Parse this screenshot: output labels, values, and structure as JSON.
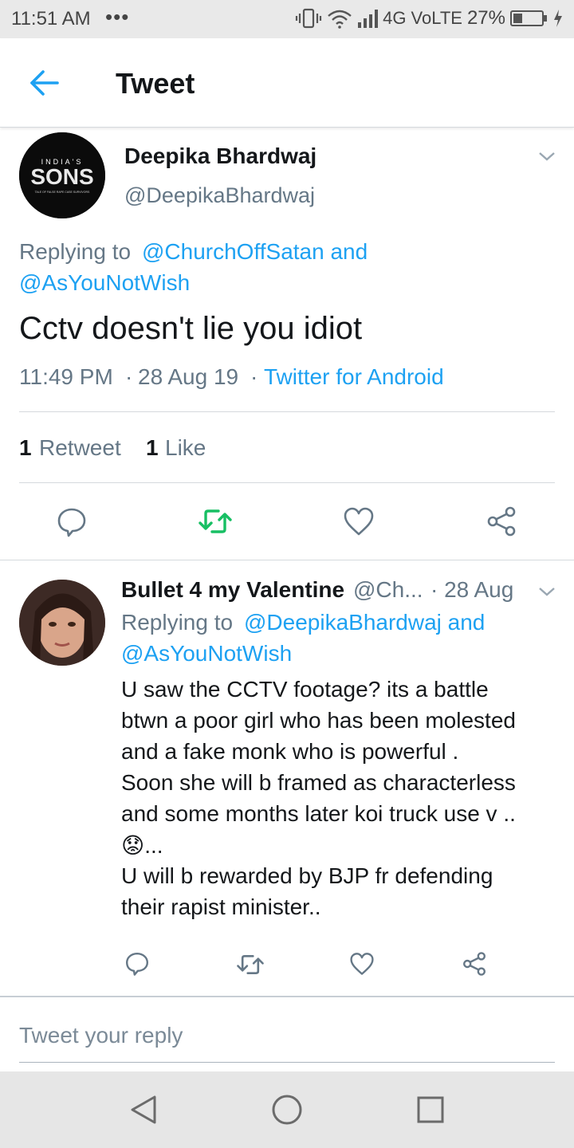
{
  "status_bar": {
    "time": "11:51 AM",
    "dots": "•••",
    "network": "4G VoLTE",
    "battery": "27%",
    "icons": [
      "vibrate-icon",
      "wifi-icon",
      "signal-icon",
      "battery-icon",
      "charging-icon"
    ]
  },
  "header": {
    "title": "Tweet",
    "back_icon": "arrow-left-icon"
  },
  "colors": {
    "accent": "#1da1f2",
    "retweet_green": "#17bf63",
    "text_primary": "#14171a",
    "text_secondary": "#657786"
  },
  "main_tweet": {
    "avatar_text_top": "INDIA'S",
    "avatar_text_main": "SONS",
    "avatar_text_sub": "TALE OF FALSE RAPE CASE SURVIVORS",
    "display_name": "Deepika Bhardwaj",
    "handle": "@DeepikaBhardwaj",
    "reply_prefix": "Replying to",
    "reply_to_1": "@ChurchOffSatan and",
    "reply_to_2": "@AsYouNotWish",
    "text": "Cctv doesn't lie you idiot",
    "time": "11:49 PM",
    "sep1": "·",
    "date": "28 Aug 19",
    "sep2": "·",
    "source": "Twitter for Android",
    "retweet_count": "1",
    "retweet_label": "Retweet",
    "like_count": "1",
    "like_label": "Like"
  },
  "reply": {
    "display_name": "Bullet 4 my Valentine",
    "handle": "@Ch...",
    "date": "· 28 Aug",
    "reply_prefix": "Replying to",
    "reply_to_1": "@DeepikaBhardwaj and",
    "reply_to_2": "@AsYouNotWish",
    "lines": [
      "U saw the CCTV footage? its a battle",
      "btwn a poor girl who has been molested",
      "and a fake monk who is powerful .",
      "Soon she will b framed as characterless",
      "and some months later koi truck use v ..",
      "😟...",
      "U will b rewarded by BJP fr defending",
      "their rapist minister.."
    ]
  },
  "compose": {
    "placeholder": "Tweet your reply"
  },
  "nav_bar": {
    "icons": [
      "nav-back-icon",
      "nav-home-icon",
      "nav-recents-icon"
    ]
  }
}
